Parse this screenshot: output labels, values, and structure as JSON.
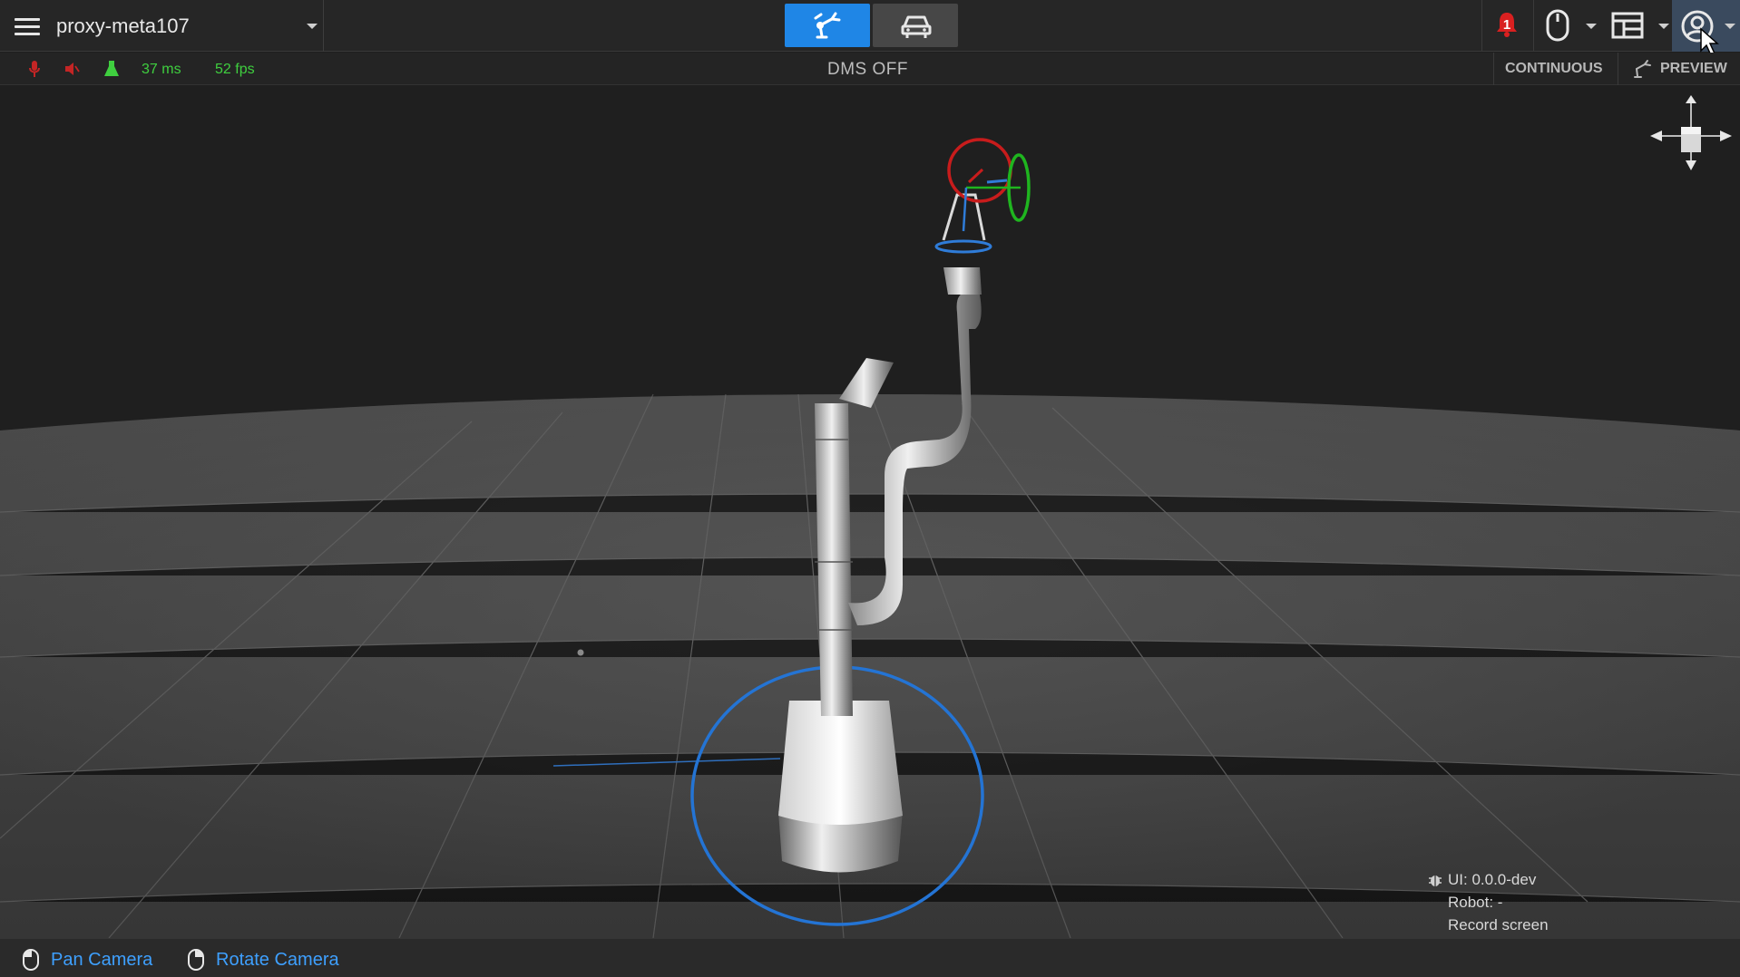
{
  "header": {
    "project_name": "proxy-meta107",
    "notifications_count": "1",
    "modes": [
      {
        "icon": "robot-arm-icon",
        "active": true
      },
      {
        "icon": "car-icon",
        "active": false
      }
    ],
    "right_icons": [
      "bell-icon",
      "mouse-icon",
      "layout-icon",
      "user-circle-icon"
    ]
  },
  "status": {
    "latency": "37 ms",
    "fps": "52 fps",
    "dms": "DMS OFF",
    "continuous_label": "CONTINUOUS",
    "preview_label": "PREVIEW",
    "icons": [
      "microphone-icon",
      "speaker-icon",
      "flask-icon"
    ]
  },
  "info": {
    "ui_version": "UI: 0.0.0-dev",
    "robot": "Robot: -",
    "record": "Record screen"
  },
  "footer": {
    "pan_label": "Pan Camera",
    "rotate_label": "Rotate Camera"
  },
  "colors": {
    "accent": "#1f86e6",
    "link": "#3ea0ff",
    "stat_green": "#3fcf3f",
    "alert_red": "#d92020"
  }
}
